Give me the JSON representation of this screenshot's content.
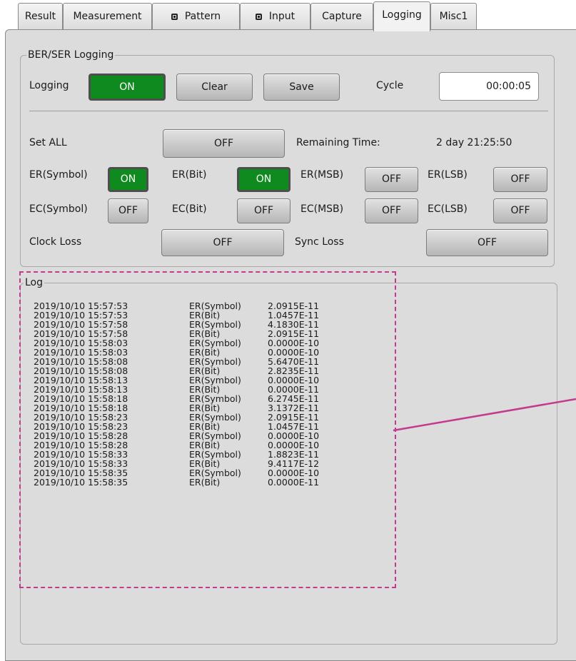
{
  "tabs": [
    {
      "label": "Result",
      "icon": null
    },
    {
      "label": "Measurement",
      "icon": null
    },
    {
      "label": "Pattern",
      "icon": "square-indicator-icon"
    },
    {
      "label": "Input",
      "icon": "square-indicator-icon"
    },
    {
      "label": "Capture",
      "icon": null
    },
    {
      "label": "Logging",
      "icon": null,
      "active": true
    },
    {
      "label": "Misc1",
      "icon": null
    }
  ],
  "ber_group": {
    "title": "BER/SER Logging",
    "logging_label": "Logging",
    "logging_state": "ON",
    "clear_label": "Clear",
    "save_label": "Save",
    "cycle_label": "Cycle",
    "cycle_value": "00:00:05",
    "set_all_label": "Set ALL",
    "set_all_state": "OFF",
    "remaining_label": "Remaining Time:",
    "remaining_value": "2 day 21:25:50",
    "er_symbol_label": "ER(Symbol)",
    "er_symbol_state": "ON",
    "er_bit_label": "ER(Bit)",
    "er_bit_state": "ON",
    "er_msb_label": "ER(MSB)",
    "er_msb_state": "OFF",
    "er_lsb_label": "ER(LSB)",
    "er_lsb_state": "OFF",
    "ec_symbol_label": "EC(Symbol)",
    "ec_symbol_state": "OFF",
    "ec_bit_label": "EC(Bit)",
    "ec_bit_state": "OFF",
    "ec_msb_label": "EC(MSB)",
    "ec_msb_state": "OFF",
    "ec_lsb_label": "EC(LSB)",
    "ec_lsb_state": "OFF",
    "clock_loss_label": "Clock Loss",
    "clock_loss_state": "OFF",
    "sync_loss_label": "Sync Loss",
    "sync_loss_state": "OFF"
  },
  "log": {
    "title": "Log",
    "rows": [
      [
        "2019/10/10 15:57:53",
        "ER(Symbol)",
        "2.0915E-11"
      ],
      [
        "2019/10/10 15:57:53",
        "ER(Bit)",
        "1.0457E-11"
      ],
      [
        "2019/10/10 15:57:58",
        "ER(Symbol)",
        "4.1830E-11"
      ],
      [
        "2019/10/10 15:57:58",
        "ER(Bit)",
        "2.0915E-11"
      ],
      [
        "2019/10/10 15:58:03",
        "ER(Symbol)",
        "0.0000E-10"
      ],
      [
        "2019/10/10 15:58:03",
        "ER(Bit)",
        "0.0000E-10"
      ],
      [
        "2019/10/10 15:58:08",
        "ER(Symbol)",
        "5.6470E-11"
      ],
      [
        "2019/10/10 15:58:08",
        "ER(Bit)",
        "2.8235E-11"
      ],
      [
        "2019/10/10 15:58:13",
        "ER(Symbol)",
        "0.0000E-10"
      ],
      [
        "2019/10/10 15:58:13",
        "ER(Bit)",
        "0.0000E-11"
      ],
      [
        "2019/10/10 15:58:18",
        "ER(Symbol)",
        "6.2745E-11"
      ],
      [
        "2019/10/10 15:58:18",
        "ER(Bit)",
        "3.1372E-11"
      ],
      [
        "2019/10/10 15:58:23",
        "ER(Symbol)",
        "2.0915E-11"
      ],
      [
        "2019/10/10 15:58:23",
        "ER(Bit)",
        "1.0457E-11"
      ],
      [
        "2019/10/10 15:58:28",
        "ER(Symbol)",
        "0.0000E-10"
      ],
      [
        "2019/10/10 15:58:28",
        "ER(Bit)",
        "0.0000E-10"
      ],
      [
        "2019/10/10 15:58:33",
        "ER(Symbol)",
        "1.8823E-11"
      ],
      [
        "2019/10/10 15:58:33",
        "ER(Bit)",
        "9.4117E-12"
      ],
      [
        "2019/10/10 15:58:35",
        "ER(Symbol)",
        "0.0000E-10"
      ],
      [
        "2019/10/10 15:58:35",
        "ER(Bit)",
        "0.0000E-11"
      ]
    ]
  },
  "colors": {
    "on_green": "#0f8a1f",
    "panel_gray": "#dcdcdc",
    "annotation_magenta": "#c33a8e"
  }
}
